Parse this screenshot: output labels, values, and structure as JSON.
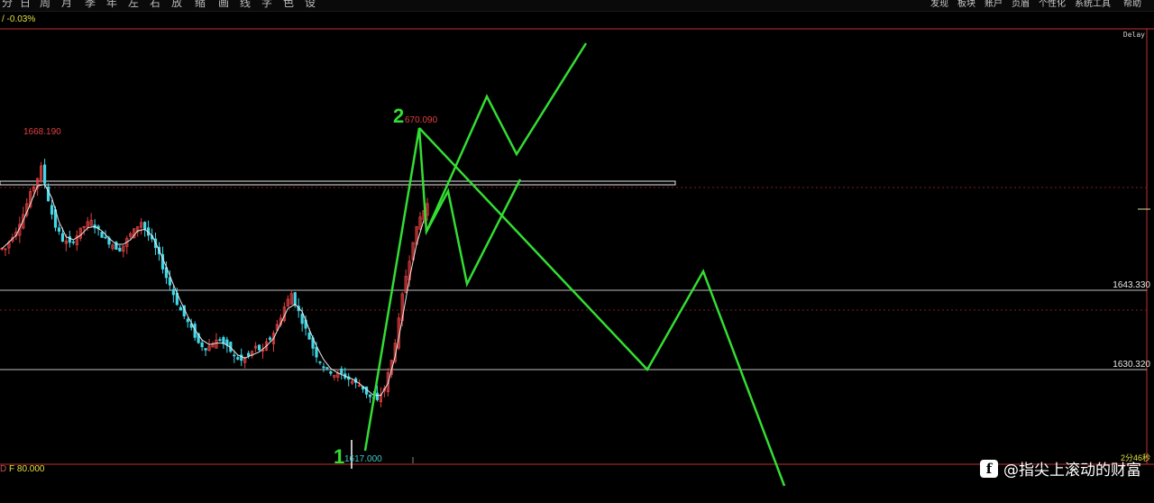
{
  "toolbar": {
    "icons": [
      "分",
      "日",
      "周",
      "月",
      "季",
      "年",
      "左",
      "右",
      "放",
      "缩",
      "画",
      "线",
      "字",
      "色",
      "设"
    ],
    "menus": [
      "发现",
      "板块",
      "账户",
      "页眉",
      "个性化",
      "系统工具",
      "帮助"
    ]
  },
  "indicator_top": "/ -0.03%",
  "indicator_bottom": {
    "label": "D",
    "value": "F 80.000"
  },
  "delay_label": "Delay",
  "labels": {
    "peak_left": "1668.190",
    "peak_right": "670.090",
    "low": "1617.000",
    "wave1": "1",
    "wave2": "2"
  },
  "price_tags": {
    "level1": "1643.330",
    "level2": "1630.320",
    "bottom_right": "2分46秒"
  },
  "watermark": {
    "logo": "f",
    "text": "@指尖上滚动的财富"
  },
  "colors": {
    "up": "#e84040",
    "down": "#40d8e8",
    "ma": "#e8e8e8",
    "projection": "#33dd33",
    "background": "#000000"
  },
  "chart_data": {
    "type": "candlestick",
    "price_range": [
      1603,
      1700
    ],
    "horizontal_levels": [
      {
        "value": 1643.33,
        "label": "1643.330"
      },
      {
        "value": 1630.32,
        "label": "1630.320"
      }
    ],
    "annotations": [
      {
        "text": "1668.190",
        "kind": "high"
      },
      {
        "text": "670.090",
        "kind": "high"
      },
      {
        "text": "1617.000",
        "kind": "low"
      }
    ],
    "close_path": [
      1651,
      1654,
      1657,
      1661,
      1665,
      1669,
      1662,
      1656,
      1653,
      1652,
      1654,
      1656,
      1657,
      1655,
      1653,
      1652,
      1651,
      1653,
      1655,
      1657,
      1654,
      1651,
      1647,
      1643,
      1639,
      1636,
      1633,
      1630,
      1629,
      1630,
      1631,
      1629,
      1627,
      1626,
      1627,
      1629,
      1628,
      1631,
      1634,
      1638,
      1641,
      1637,
      1633,
      1629,
      1626,
      1624,
      1623,
      1623,
      1622,
      1621,
      1620,
      1618,
      1617,
      1620,
      1626,
      1635,
      1645,
      1653,
      1658,
      1661
    ]
  }
}
